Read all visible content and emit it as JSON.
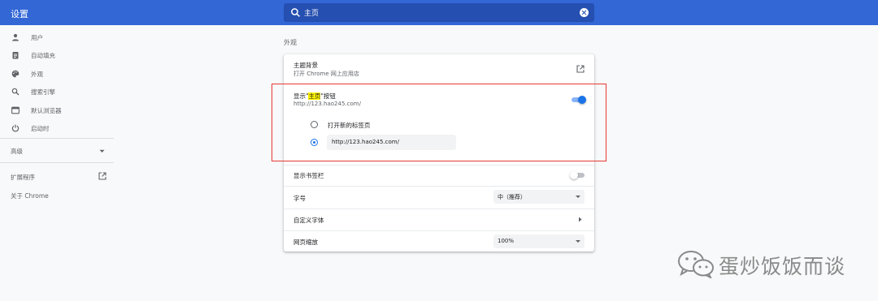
{
  "header": {
    "title": "设置"
  },
  "search": {
    "value": "主页"
  },
  "sidebar": {
    "items": [
      {
        "label": "用户",
        "icon": "person-icon"
      },
      {
        "label": "自动填充",
        "icon": "clipboard-icon"
      },
      {
        "label": "外观",
        "icon": "palette-icon"
      },
      {
        "label": "搜索引擎",
        "icon": "search-icon"
      },
      {
        "label": "默认浏览器",
        "icon": "browser-icon"
      },
      {
        "label": "启动时",
        "icon": "power-icon"
      }
    ],
    "advanced_label": "高级",
    "extensions_label": "扩展程序",
    "about_label": "关于 Chrome"
  },
  "main": {
    "section_title": "外观",
    "theme": {
      "title": "主题背景",
      "subtitle": "打开 Chrome 网上应用店"
    },
    "home_button": {
      "title_prefix": "显示\"",
      "title_highlight": "主页",
      "title_suffix": "\"按钮",
      "subtitle": "http://123.hao245.com/",
      "enabled": true,
      "options": [
        {
          "label": "打开新的标签页",
          "checked": false
        },
        {
          "value": "http://123.hao245.com/",
          "checked": true
        }
      ]
    },
    "bookmarks_bar": {
      "label": "显示书签栏",
      "enabled": false
    },
    "font_size": {
      "label": "字号",
      "value": "中（推荐）"
    },
    "custom_fonts": {
      "label": "自定义字体"
    },
    "page_zoom": {
      "label": "网页缩放",
      "value": "100%"
    }
  },
  "watermark": {
    "text": "蛋炒饭饭而谈"
  },
  "colors": {
    "header": "#3367d6",
    "accent": "#1a73e8",
    "highlight": "#fff200",
    "annotation_box": "#e53935"
  }
}
